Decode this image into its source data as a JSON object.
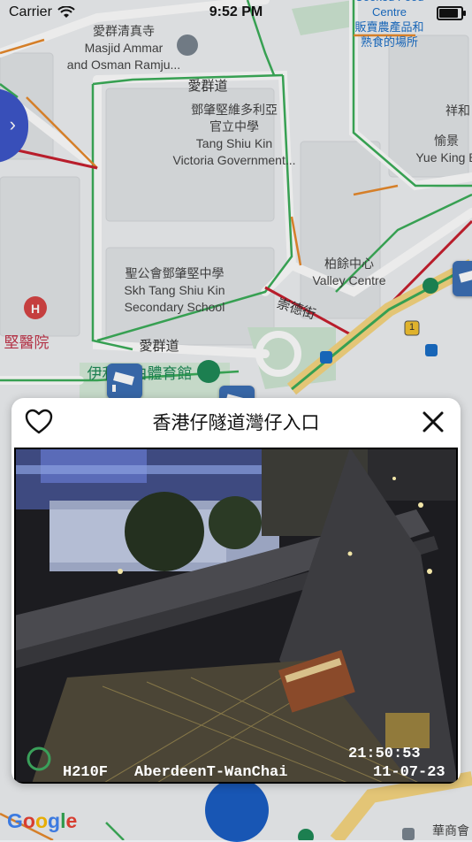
{
  "status_bar": {
    "carrier": "Carrier",
    "time": "9:52 PM",
    "battery_level": 0.95
  },
  "map": {
    "labels": {
      "mosque": "愛群清真寺\nMasjid Ammar\nand Osman Ramju...",
      "road_top": "愛群道",
      "school_gov": "鄧肇堅維多利亞\n官立中學\nTang Shiu Kin\nVictoria Government...",
      "school_sec": "聖公會鄧肇堅中學\nSkh Tang Shiu Kin\nSecondary School",
      "valley": "柏餘中心\nValley Centre",
      "road_chung": "崇德街",
      "road_bottom": "愛群道",
      "hospital": "堅醫院",
      "sports": "伊利沙伯體育館",
      "food_centre": "Cooked Food Centre\n販賣農產品和\n熟食的場所",
      "right_top": "祥和",
      "yue_king": "愉景\nYue King B",
      "bottom_right": "華商會",
      "google": "Google"
    },
    "badges": {
      "route": "1"
    },
    "colors": {
      "traffic_green": "#3cae5a",
      "traffic_orange": "#e88a2d",
      "traffic_red": "#c8202f",
      "camera_marker": "#3c6fb5"
    }
  },
  "modal": {
    "title": "香港仔隧道灣仔入口",
    "favorite_icon": "heart-outline-icon",
    "close_icon": "close-icon",
    "camera": {
      "timestamp_time": "21:50:53",
      "timestamp_date": "11-07-23",
      "caption_code": "H210F",
      "caption_name": "AberdeenT-WanChai"
    }
  },
  "controls": {
    "sidebar_toggle_icon": "chevron-right-icon"
  }
}
